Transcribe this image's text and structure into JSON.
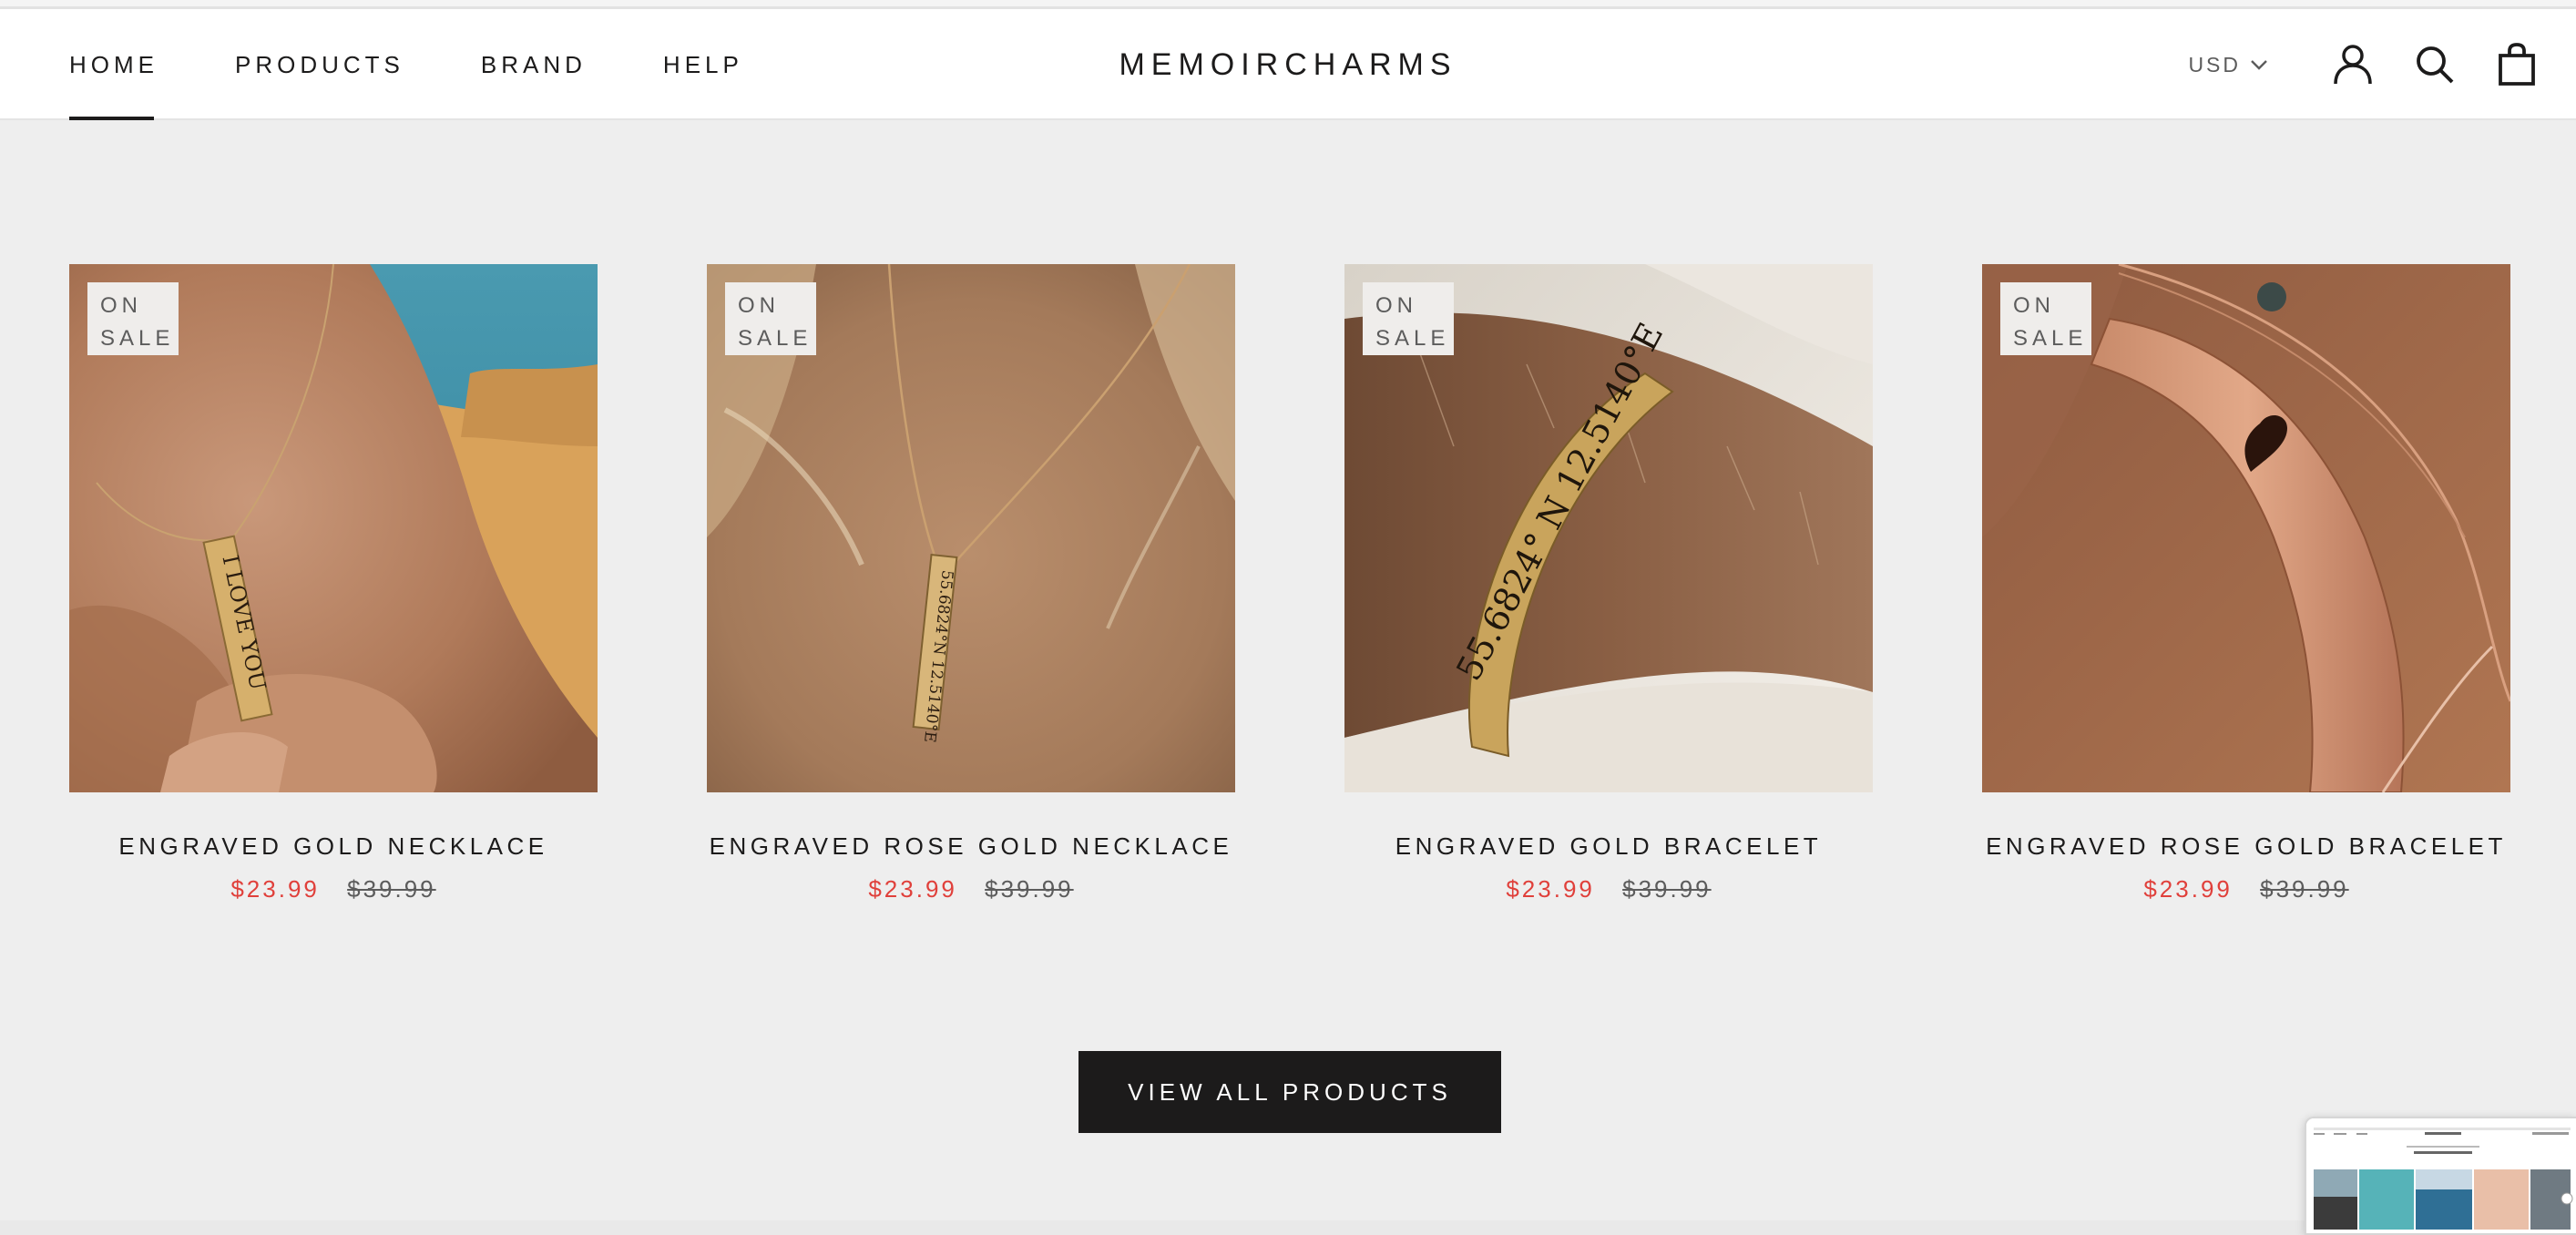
{
  "header": {
    "nav": [
      "HOME",
      "PRODUCTS",
      "BRAND",
      "HELP"
    ],
    "active_nav": "HOME",
    "logo": "MEMOIRCHARMS",
    "currency": "USD",
    "icons": [
      "account-icon",
      "search-icon",
      "cart-icon"
    ]
  },
  "products": [
    {
      "badge_line1": "ON",
      "badge_line2": "SALE",
      "name": "ENGRAVED GOLD NECKLACE",
      "price": "$23.99",
      "compare_price": "$39.99",
      "engraving": "I LOVE YOU"
    },
    {
      "badge_line1": "ON",
      "badge_line2": "SALE",
      "name": "ENGRAVED ROSE GOLD NECKLACE",
      "price": "$23.99",
      "compare_price": "$39.99",
      "engraving": "55.6824°N 12.5140°E"
    },
    {
      "badge_line1": "ON",
      "badge_line2": "SALE",
      "name": "ENGRAVED GOLD BRACELET",
      "price": "$23.99",
      "compare_price": "$39.99",
      "engraving": "55.6824° N 12.5140°E"
    },
    {
      "badge_line1": "ON",
      "badge_line2": "SALE",
      "name": "ENGRAVED ROSE GOLD BRACELET",
      "price": "$23.99",
      "compare_price": "$39.99"
    }
  ],
  "cta": {
    "view_all": "VIEW ALL PRODUCTS"
  },
  "colors": {
    "sale": "#e0403b",
    "button": "#1c1b1b",
    "background": "#eeeeee"
  }
}
